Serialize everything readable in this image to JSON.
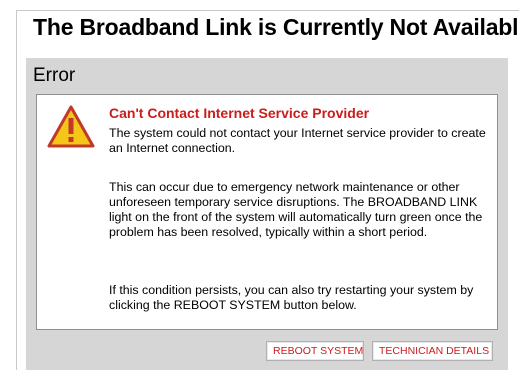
{
  "page": {
    "title": "The Broadband Link is Currently Not Available"
  },
  "panel": {
    "header": "Error"
  },
  "message": {
    "icon": "warning-icon",
    "heading": "Can't Contact Internet Service Provider",
    "paragraphs": [
      "The system could not contact your Internet service provider to create an Internet connection.",
      "This can occur due to emergency network maintenance or other unforeseen temporary service disruptions. The BROADBAND LINK light on the front of the system will automatically turn green once the problem has been resolved, typically within a short period.",
      "If this condition persists, you can also try restarting your system by clicking the REBOOT SYSTEM button below."
    ]
  },
  "buttons": {
    "reboot": "REBOOT SYSTEM",
    "technician": "TECHNICIAN DETAILS"
  },
  "colors": {
    "accent": "#cc1b1b",
    "panel_bg": "#d6d6d6",
    "icon_fill": "#f5c518"
  }
}
